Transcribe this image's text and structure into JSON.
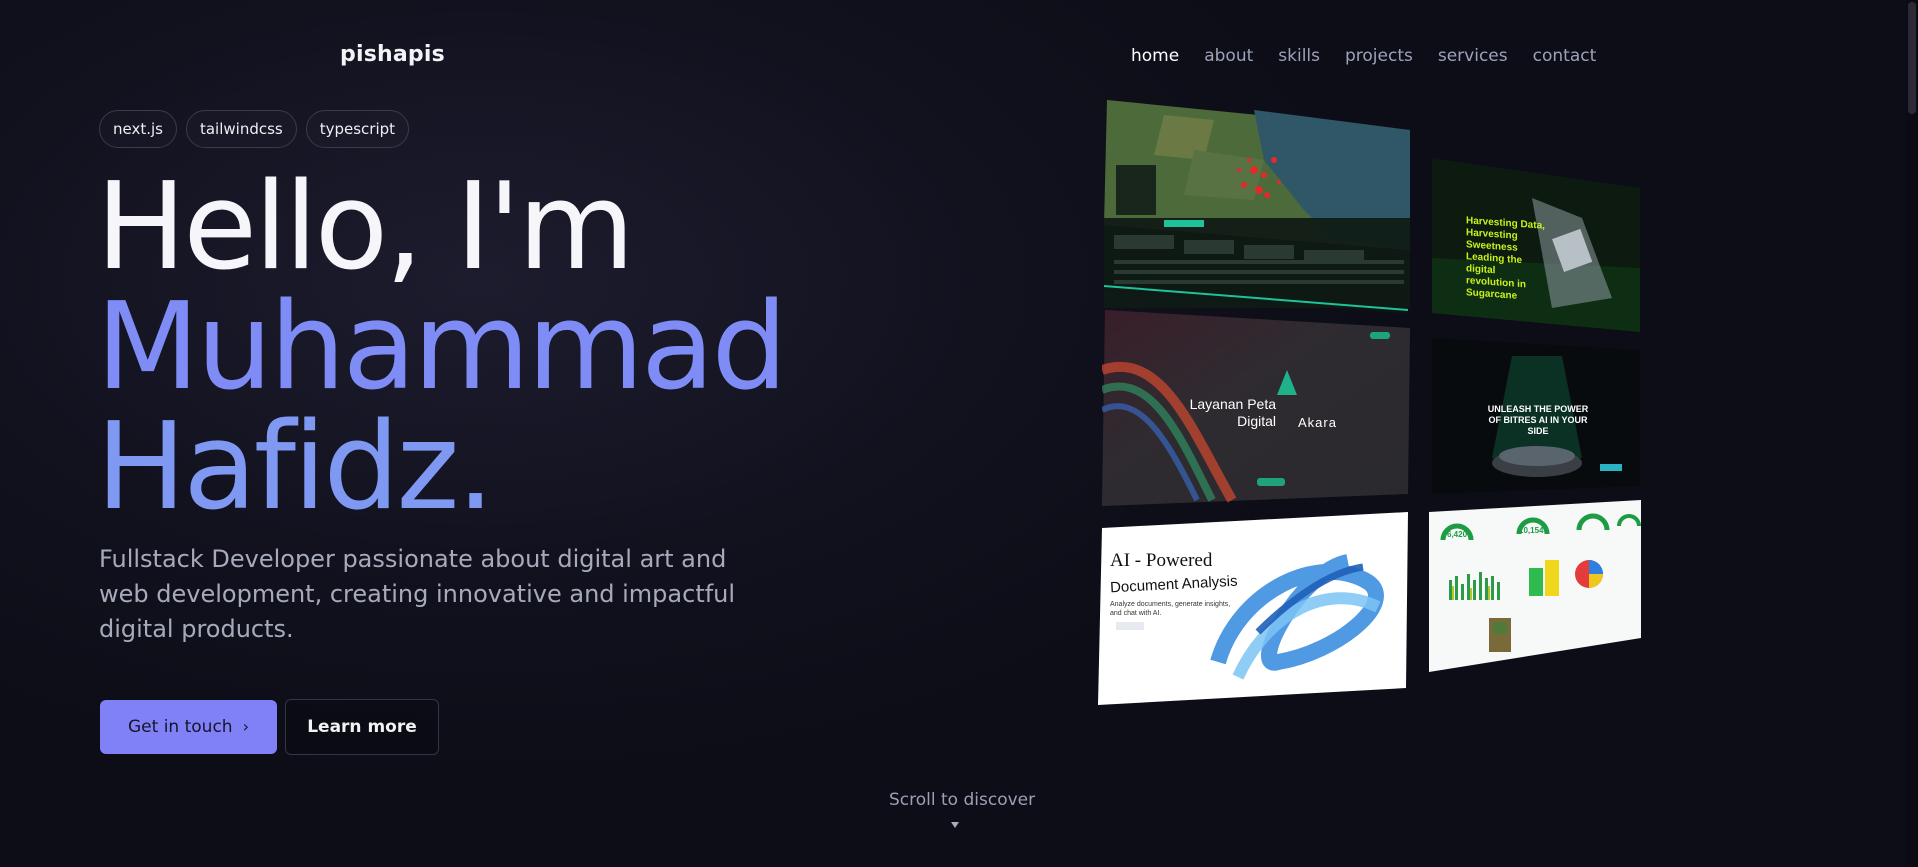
{
  "brand": "pishapis",
  "nav": [
    "home",
    "about",
    "skills",
    "projects",
    "services",
    "contact"
  ],
  "tags": [
    "next.js",
    "tailwindcss",
    "typescript"
  ],
  "hero": {
    "line1": "Hello, I'm",
    "line2": "Muhammad",
    "line3": "Hafidz."
  },
  "subtitle": "Fullstack Developer passionate about digital art and web development, creating innovative and impactful digital products.",
  "buttons": {
    "primary": "Get in touch",
    "secondary": "Learn more"
  },
  "scroll_hint": "Scroll to discover",
  "projects": {
    "sugarcane": "Harvesting Data, Harvesting Sweetness Leading the digital revolution in Sugarcane",
    "akara_left": "Layanan Peta Digital",
    "akara_right": "Akara",
    "bitres": "UNLEASH THE POWER OF BITRES AI IN YOUR SIDE",
    "ai_line1": "AI - Powered",
    "ai_line2": "Document Analysis",
    "ai_desc": "Analyze documents, generate insights, and chat with AI.",
    "dash_stat1": "6,420",
    "dash_stat2": "10,154"
  },
  "colors": {
    "accent": "#8080f7",
    "name_color": "#7f8cf5"
  }
}
